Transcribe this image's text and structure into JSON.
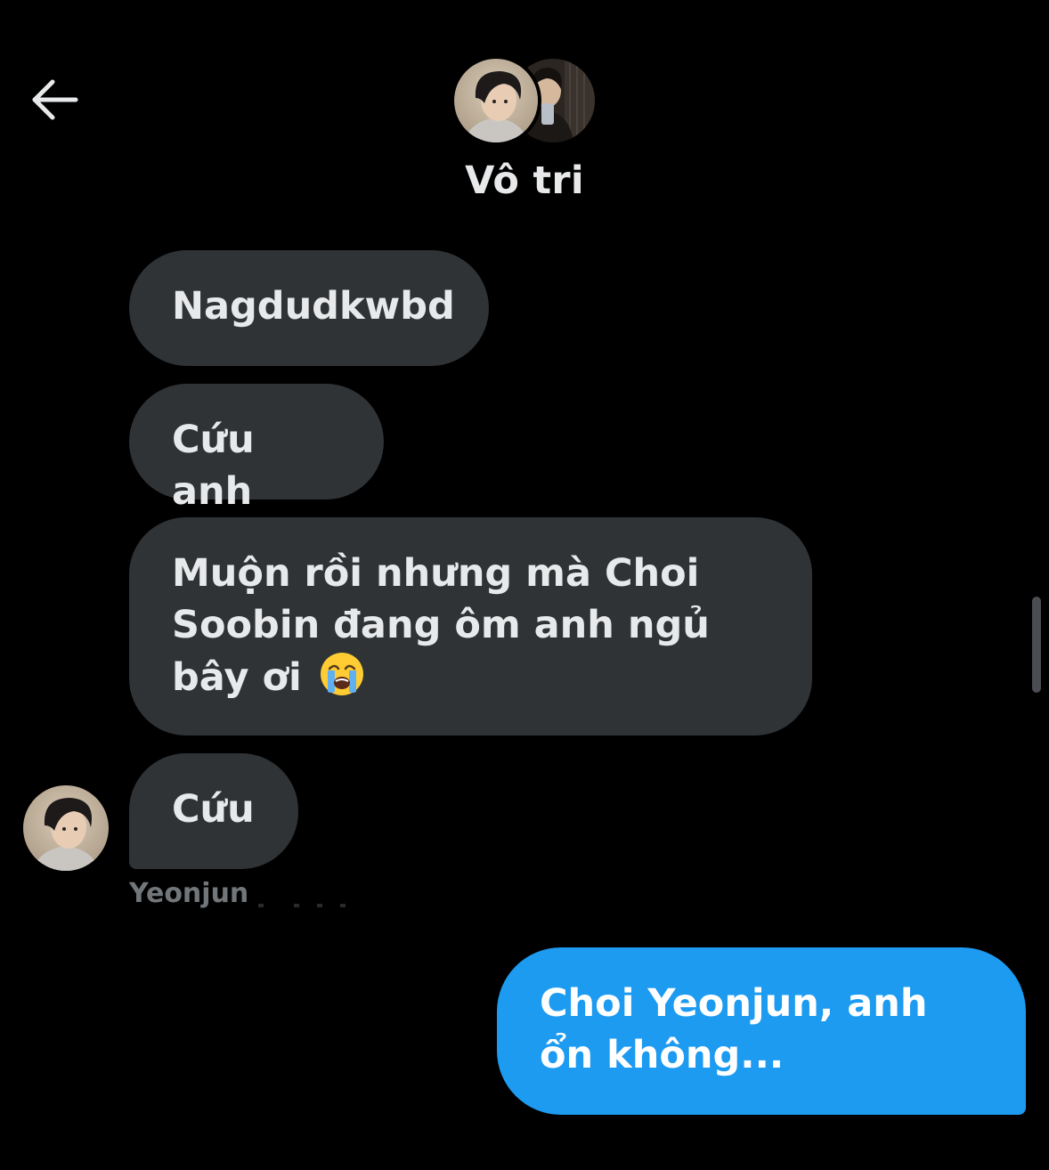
{
  "header": {
    "back_icon": "arrow-left-icon",
    "title": "Vô tri"
  },
  "messages": [
    {
      "sender": "received",
      "text": "Nagdudkwbd"
    },
    {
      "sender": "received",
      "text": "Cứu anh"
    },
    {
      "sender": "received",
      "text": "Muộn rồi nhưng mà Choi Soobin đang ôm anh ngủ bây ơi",
      "emoji": "loudly-crying-face-icon"
    },
    {
      "sender": "received",
      "text": "Cứu"
    },
    {
      "sender": "sent",
      "text": "Choi Yeonjun, anh ổn không..."
    }
  ],
  "sender_label": "Yeonjun",
  "colors": {
    "background": "#000000",
    "received_bubble": "#2f3336",
    "sent_bubble": "#1d9bf0",
    "text_primary": "#e7e9ea",
    "text_secondary": "#71767b"
  }
}
